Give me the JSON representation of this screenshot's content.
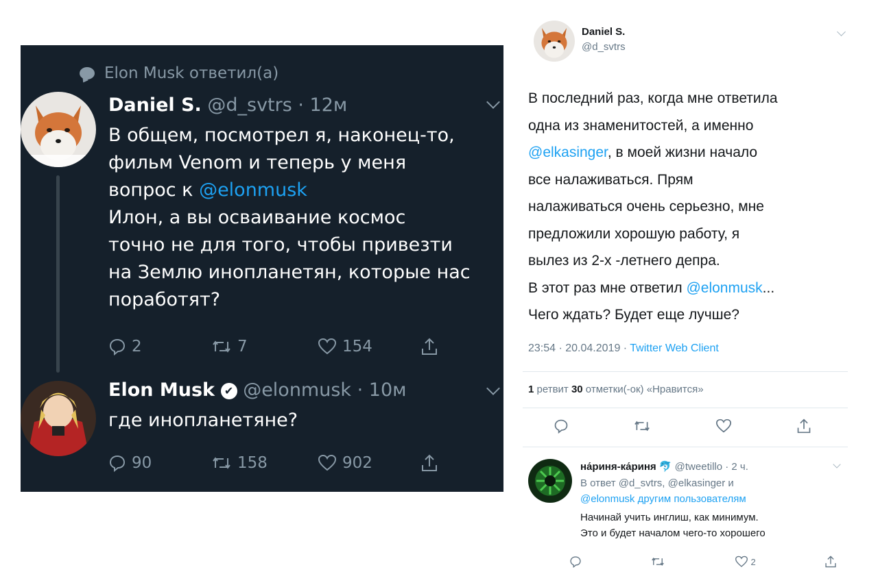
{
  "left_thread": {
    "context": "Elon Musk ответил(а)",
    "tweet1": {
      "name": "Daniel S.",
      "meta": "@d_svtrs · 12м",
      "lines": [
        "В общем, посмотрел я, наконец-то,",
        "фильм Venom и теперь у меня",
        "вопрос к ",
        "Илон, а вы осваивание космос",
        "точно не для того, чтобы привезти",
        "на Землю инопланетян, которые нас",
        "поработят?"
      ],
      "mention": "@elonmusk",
      "replies": "2",
      "retweets": "7",
      "likes": "154"
    },
    "tweet2": {
      "name": "Elon Musk",
      "meta": "@elonmusk · 10м",
      "text": "где инопланетяне?",
      "replies": "90",
      "retweets": "158",
      "likes": "902"
    }
  },
  "right_tweet": {
    "name": "Daniel S.",
    "handle": "@d_svtrs",
    "lines": [
      "В последний раз, когда мне ответила",
      "одна из знаменитостей, а именно",
      ", в моей жизни начало",
      "все налаживаться. Прям",
      "налаживаться очень серьезно, мне",
      "предложили хорошую работу, я",
      "вылез из 2-х -летнего депра.",
      "В этот раз мне ответил ",
      "Чего ждать? Будет еще лучше?"
    ],
    "mention1": "@elkasinger",
    "mention2": "@elonmusk",
    "ellipsis": "...",
    "timestamp": "23:54 · 20.04.2019 · ",
    "source": "Twitter Web Client",
    "retweets_count": "1",
    "retweets_label": " ретвит ",
    "likes_count": "30",
    "likes_label": " отметки(-ок) «Нравится»",
    "reply": {
      "name": "на́риня-ка́риня",
      "emoji": "🐬",
      "meta": " @tweetillo · 2 ч.",
      "in_reply_line1": "В ответ @d_svtrs, @elkasinger и",
      "in_reply_line2": "@elonmusk другим пользователям",
      "text_line1": "Начинай учить инглиш,  как минимум.",
      "text_line2": "Это и будет началом чего-то хорошего",
      "likes": "2"
    }
  },
  "colors": {
    "dark_bg": "#15202b",
    "dark_secondary": "#8899a6",
    "link": "#1da1f2",
    "light_secondary": "#657786"
  }
}
